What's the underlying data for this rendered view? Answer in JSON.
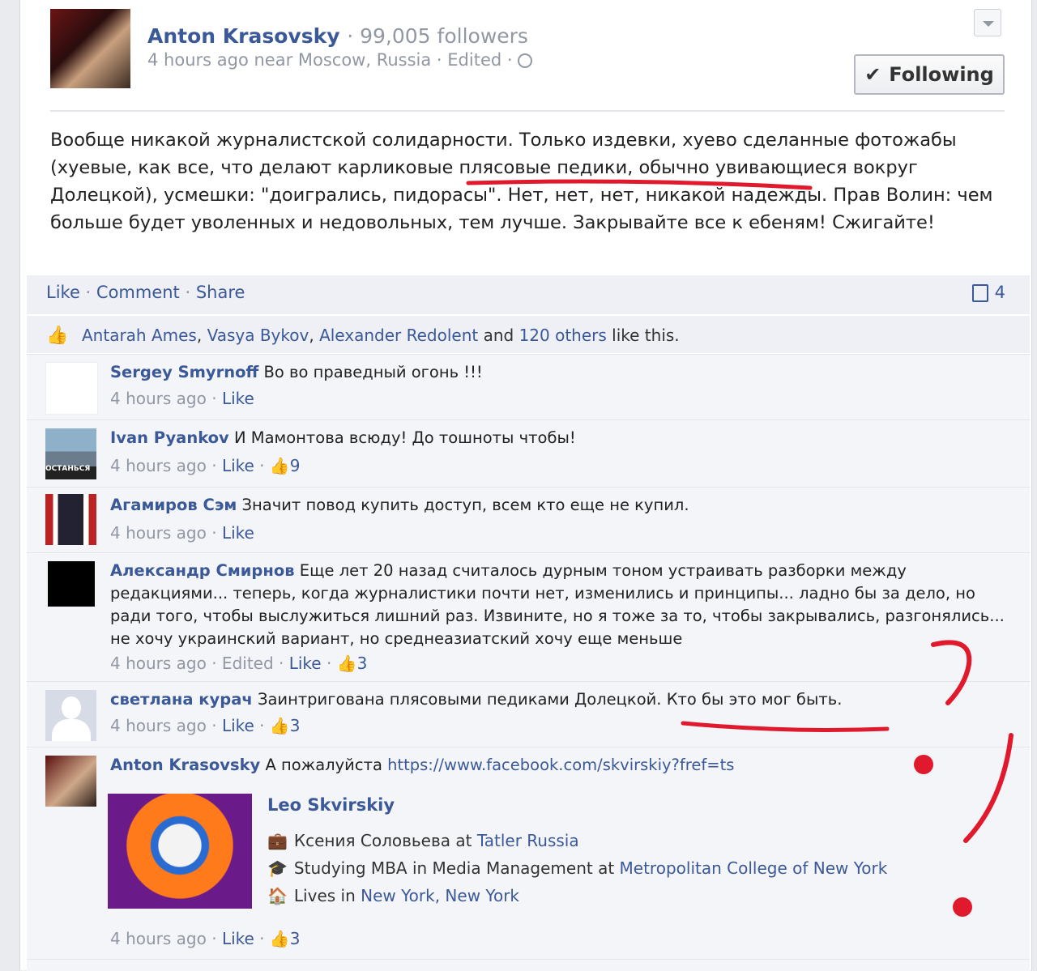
{
  "post": {
    "author": "Anton Krasovsky",
    "followers": "· 99,005 followers",
    "meta": "4 hours ago near Moscow, Russia · Edited ·",
    "following_label": "Following",
    "text_before": "Вообще никакой журналистской солидарности. Только издевки, хуево сделанные фотожабы (хуевые, как все, что делают ",
    "text_highlight": "карликовые плясовые педики,",
    "text_after": " обычно увивающиеся вокруг Долецкой), усмешки: \"доигрались, пидорасы\". Нет, нет, нет, никакой надежды. Прав Волин: чем больше будет уволенных и недовольных, тем лучше. Закрывайте все к ебеням! Сжигайте!"
  },
  "actions": {
    "like": "Like",
    "sep1": " · ",
    "comment": "Comment",
    "sep2": " · ",
    "share": "Share",
    "comment_count": "4"
  },
  "likes": {
    "name1": "Antarah Ames",
    "name2": "Vasya Bykov",
    "name3": "Alexander Redolent",
    "and": " and ",
    "others": "120 others",
    "suffix": " like this."
  },
  "comments": [
    {
      "author": "Sergey Smyrnoff",
      "text": " Во во праведный огонь !!!",
      "meta": "4 hours ago · ",
      "like": "Like",
      "likes": ""
    },
    {
      "author": "Ivan Pyankov",
      "text": " И Мамонтова всюду! До тошноты чтобы!",
      "meta": "4 hours ago · ",
      "like": "Like",
      "likes": "9"
    },
    {
      "author": "Агамиров Сэм",
      "text": " Значит повод купить доступ, всем кто еще не купил.",
      "meta": "4 hours ago · ",
      "like": "Like",
      "likes": ""
    },
    {
      "author": "Александр Смирнов",
      "text": " Еще лет 20 назад считалось дурным тоном устраивать разборки между редакциями... теперь, когда журналистики почти нет, изменились и принципы... ладно бы за дело, но ради того, чтобы выслужиться лишний раз. Извините, но я тоже за то, чтобы закрывались, разгонялись... не хочу украинский вариант, но среднеазиатский хочу еще меньше",
      "meta": "4 hours ago · Edited · ",
      "like": "Like",
      "likes": "3"
    },
    {
      "author": "светлана курач",
      "text": " Заинтригована плясовыми педиками Долецкой. Кто бы это мог быть.",
      "meta": "4 hours ago · ",
      "like": "Like",
      "likes": "3"
    },
    {
      "author": "Anton Krasovsky",
      "text": " А пожалуйста ",
      "link": "https://www.facebook.com/skvirskiy?fref=ts",
      "meta": "4 hours ago · ",
      "like": "Like",
      "likes": "3"
    }
  ],
  "avatar_caption": "ОСТАНЬСЯ",
  "share": {
    "name": "Leo Skvirskiy",
    "work_prefix": "Ксения Соловьева at ",
    "work_link": "Tatler Russia",
    "study_prefix": "Studying MBA in Media Management at ",
    "study_link": "Metropolitan College of New York",
    "lives_prefix": "Lives in ",
    "lives_link": "New York, New York"
  }
}
